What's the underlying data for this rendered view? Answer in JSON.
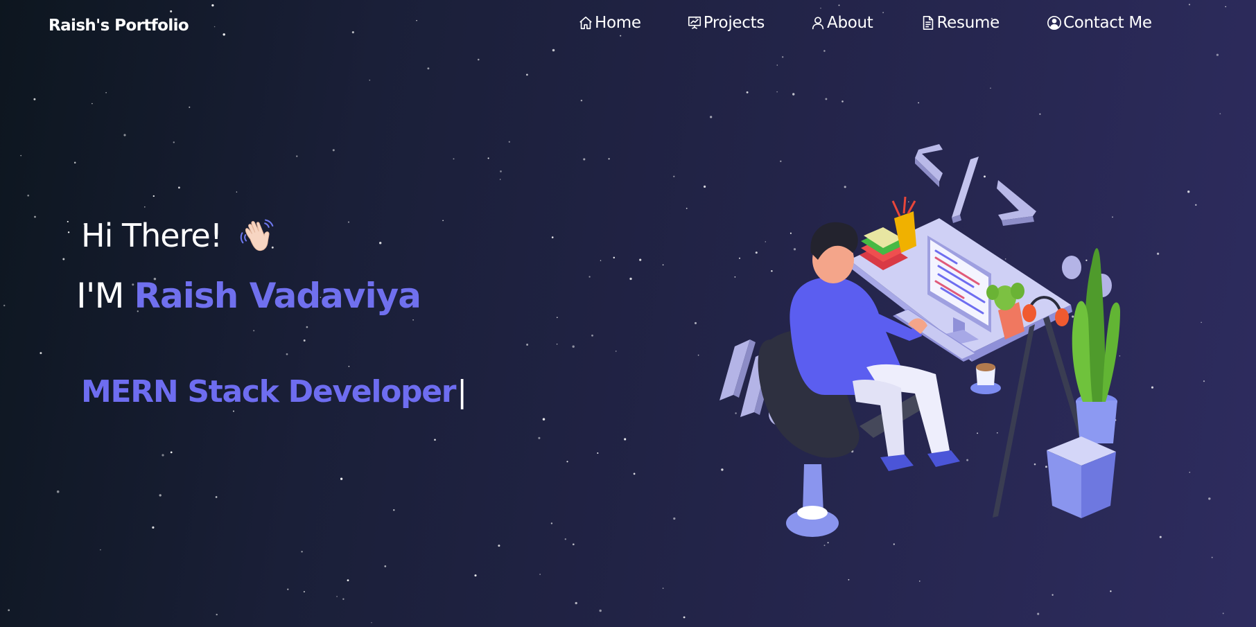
{
  "navbar": {
    "brand": "Raish's Portfolio",
    "links": [
      {
        "label": "Home",
        "icon": "home-icon"
      },
      {
        "label": "Projects",
        "icon": "presentation-chart-icon"
      },
      {
        "label": "About",
        "icon": "user-icon"
      },
      {
        "label": "Resume",
        "icon": "document-icon"
      },
      {
        "label": "Contact Me",
        "icon": "user-circle-icon"
      }
    ]
  },
  "hero": {
    "greeting": "Hi There!",
    "greeting_icon": "waving-hand-icon",
    "intro_prefix": "I'M",
    "name": "Raish Vadaviya",
    "role": "MERN Stack Developer",
    "cursor": "|",
    "illustration": "developer-at-desk-illustration"
  },
  "colors": {
    "accent": "#7070ee",
    "background_start": "#0d161f",
    "background_end": "#2e2c5f",
    "text": "#ffffff"
  }
}
